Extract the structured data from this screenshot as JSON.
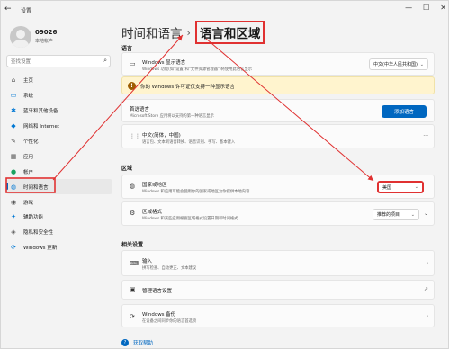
{
  "window": {
    "title": "设置",
    "back_glyph": "←",
    "controls": [
      "—",
      "☐",
      "✕"
    ]
  },
  "profile": {
    "name": "09026",
    "subtitle": "本地帐户"
  },
  "search": {
    "placeholder": "查找设置"
  },
  "nav": {
    "items": [
      {
        "label": "主页",
        "icon": "home-icon",
        "color": "#555555"
      },
      {
        "label": "系统",
        "icon": "monitor-icon",
        "color": "#0078d4"
      },
      {
        "label": "蓝牙和其他设备",
        "icon": "bluetooth-icon",
        "color": "#0078d4"
      },
      {
        "label": "网络和 Internet",
        "icon": "wifi-icon",
        "color": "#0078d4"
      },
      {
        "label": "个性化",
        "icon": "pen-icon",
        "color": "#555555"
      },
      {
        "label": "应用",
        "icon": "apps-icon",
        "color": "#555555"
      },
      {
        "label": "帐户",
        "icon": "person-icon",
        "color": "#1aa260"
      },
      {
        "label": "时间和语言",
        "icon": "globe-clock-icon",
        "color": "#0078d4"
      },
      {
        "label": "游戏",
        "icon": "gamepad-icon",
        "color": "#555555"
      },
      {
        "label": "辅助功能",
        "icon": "accessibility-icon",
        "color": "#0078d4"
      },
      {
        "label": "隐私和安全性",
        "icon": "shield-icon",
        "color": "#555555"
      },
      {
        "label": "Windows 更新",
        "icon": "update-icon",
        "color": "#0078d4"
      }
    ],
    "active_index": 7
  },
  "breadcrumb": {
    "parent": "时间和语言",
    "separator": "›",
    "current": "语言和区域"
  },
  "language": {
    "section_title": "语言",
    "display_language": {
      "title": "Windows 显示语言",
      "subtitle": "Windows 功能(如\"设置\"和\"文件资源管理器\")将使用此语言显示",
      "value": "中文(中华人民共和国)"
    },
    "warning": "你的 Windows 许可证仅支持一种显示语言",
    "preferred": {
      "title": "首选语言",
      "subtitle": "Microsoft Store 应用将以支持的第一种语言显示",
      "button": "添加语言"
    },
    "chinese": {
      "title": "中文(简体，中国)",
      "subtitle": "语言包、文本到语音转换、语音识别、手写、基本键入",
      "more": "···"
    }
  },
  "region": {
    "section_title": "区域",
    "country": {
      "title": "国家或地区",
      "subtitle": "Windows 和应用可能会使用你的国家或地区为你提供本地内容",
      "value": "美国"
    },
    "format": {
      "title": "区域格式",
      "subtitle": "Windows 和某些应用根据区域格式设置日期和时间格式",
      "value": "推荐的项目"
    }
  },
  "related": {
    "section_title": "相关设置",
    "typing": {
      "title": "输入",
      "subtitle": "拼写检查、自动更正、文本建议"
    },
    "admin": {
      "title": "管理语言设置"
    },
    "backup": {
      "title": "Windows 备份",
      "subtitle": "在设备之间同步你的语言首选项"
    }
  },
  "help": {
    "label": "获取帮助"
  },
  "colors": {
    "accent": "#0067c0",
    "annotation": "#e03131",
    "warning_bg": "#fff4ce"
  }
}
